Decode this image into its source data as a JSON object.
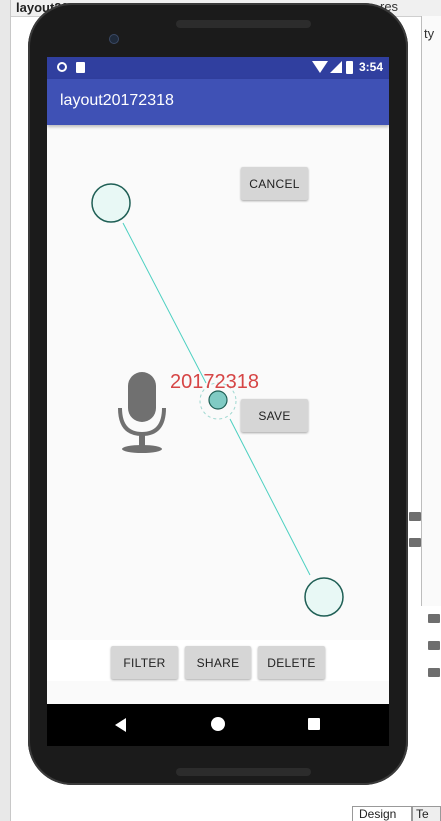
{
  "ide": {
    "tab_title": "layout20172318",
    "top_right_text": "res",
    "right_panel_text": "ty",
    "bottom_tab_design": "Design",
    "bottom_tab_text": "Te"
  },
  "status_bar": {
    "time": "3:54"
  },
  "app_bar": {
    "title": "layout20172318"
  },
  "content": {
    "number_label": "20172318",
    "cancel_label": "CANCEL",
    "save_label": "SAVE"
  },
  "bottom_bar": {
    "filter_label": "FILTER",
    "share_label": "SHARE",
    "delete_label": "DELETE"
  },
  "colors": {
    "status_bar": "#303f9f",
    "app_bar": "#3f51b5",
    "number_text": "#d64545",
    "handle_fill": "#e8f8f5",
    "center_handle_fill": "#80cbc4",
    "connector_line": "#4dd0c1",
    "mic_icon": "#707070",
    "button_bg": "#d6d6d6"
  }
}
